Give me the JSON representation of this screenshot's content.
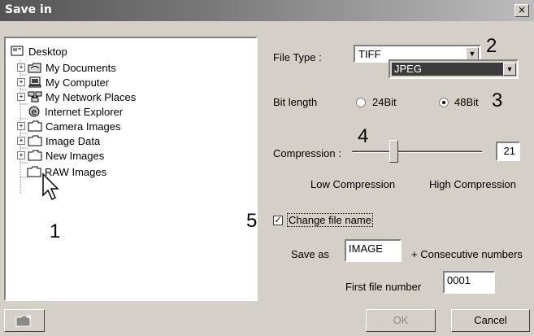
{
  "window": {
    "title": "Save in",
    "close_label": "×"
  },
  "tree": {
    "items": [
      {
        "label": "Desktop",
        "icon": "desktop-icon"
      },
      {
        "label": "My Documents",
        "icon": "documents-icon",
        "expander": "+"
      },
      {
        "label": "My Computer",
        "icon": "computer-icon",
        "expander": "+"
      },
      {
        "label": "My Network Places",
        "icon": "network-icon",
        "expander": "+"
      },
      {
        "label": "Internet Explorer",
        "icon": "ie-icon"
      },
      {
        "label": "Camera Images",
        "icon": "folder-icon",
        "expander": "+"
      },
      {
        "label": "Image Data",
        "icon": "folder-icon",
        "expander": "+"
      },
      {
        "label": "New Images",
        "icon": "folder-icon",
        "expander": "+"
      },
      {
        "label": "RAW Images",
        "icon": "folder-icon"
      }
    ]
  },
  "callouts": {
    "c1": "1",
    "c2": "2",
    "c3": "3",
    "c4": "4",
    "c5": "5"
  },
  "file_type": {
    "label": "File Type :",
    "value": "TIFF",
    "option_highlight": "JPEG"
  },
  "bit_length": {
    "label": "Bit length",
    "opt24": "24Bit",
    "opt48": "48Bit",
    "selected": "48Bit"
  },
  "compression": {
    "label": "Compression :",
    "value": "21",
    "low_label": "Low Compression",
    "high_label": "High Compression",
    "slider_fraction": 0.32
  },
  "change_name": {
    "label": "Change file name",
    "checked": true
  },
  "save_as": {
    "label": "Save as",
    "value": "IMAGE",
    "suffix": "+ Consecutive numbers"
  },
  "first_number": {
    "label": "First file number",
    "value": "0001"
  },
  "buttons": {
    "ok": "OK",
    "cancel": "Cancel"
  }
}
